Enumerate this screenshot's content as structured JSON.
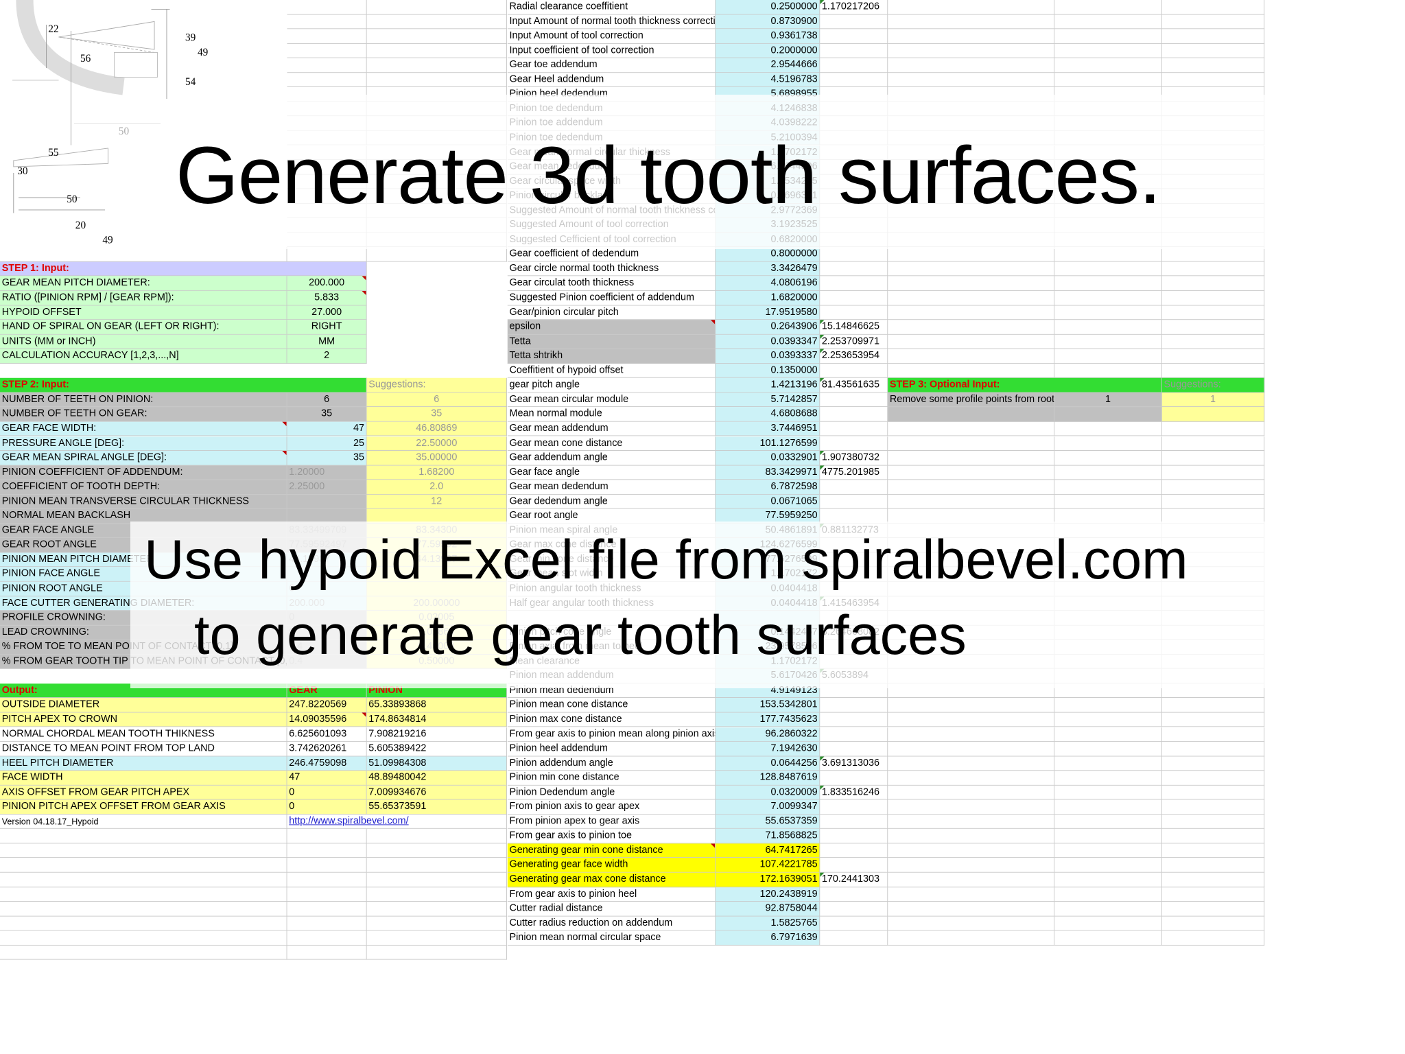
{
  "title_overlay": "Generate 3d tooth surfaces.",
  "subtitle_overlay": [
    "Use hypoid Excel file from spiralbevel.com",
    "to generate gear tooth surfaces"
  ],
  "drawing_labels": [
    "22",
    "39",
    "56",
    "49",
    "54",
    "50",
    "55",
    "30",
    "50",
    "20",
    "49"
  ],
  "colors": {
    "input": "#ccffcc",
    "header": "#33dd33",
    "output": "#ffff99",
    "gray": "#c0c0c0",
    "cyan": "#ccf2f7",
    "highlight": "#ffff00"
  },
  "step1": {
    "header": "STEP 1: Input:",
    "rows": [
      {
        "label": "GEAR MEAN PITCH DIAMETER:",
        "value": "200.000"
      },
      {
        "label": "RATIO ([PINION RPM] / [GEAR RPM]):",
        "value": "5.833"
      },
      {
        "label": "HYPOID OFFSET",
        "value": "27.000"
      },
      {
        "label": "HAND OF SPIRAL ON GEAR (LEFT OR RIGHT):",
        "value": "RIGHT"
      },
      {
        "label": "UNITS (MM or INCH)",
        "value": "MM"
      },
      {
        "label": "CALCULATION ACCURACY [1,2,3,...,N]",
        "value": "2"
      }
    ]
  },
  "step2": {
    "header": "STEP 2: Input:",
    "suggestions_label": "Suggestions:",
    "rows": [
      {
        "label": "NUMBER OF TEETH ON PINION:",
        "value": "6",
        "suggestion": "6"
      },
      {
        "label": "NUMBER OF TEETH ON GEAR:",
        "value": "35",
        "suggestion": "35"
      },
      {
        "label": "GEAR FACE WIDTH:",
        "value": "47",
        "suggestion": "46.80869"
      },
      {
        "label": "PRESSURE ANGLE [DEG]:",
        "value": "25",
        "suggestion": "22.50000"
      },
      {
        "label": "GEAR MEAN SPIRAL ANGLE [DEG]:",
        "value": "35",
        "suggestion": "35.00000"
      },
      {
        "label": "PINION COEFFICIENT OF ADDENDUM:",
        "value": "1.20000",
        "suggestion": "1.68200"
      },
      {
        "label": "COEFFICIENT OF TOOTH DEPTH:",
        "value": "2.25000",
        "suggestion": "2.0"
      },
      {
        "label": "PINION MEAN TRANSVERSE CIRCULAR THICKNESS",
        "value": "",
        "suggestion": "12"
      },
      {
        "label": "NORMAL MEAN BACKLASH",
        "value": "",
        "suggestion": ""
      },
      {
        "label": "GEAR FACE ANGLE",
        "value": "83.33499709",
        "suggestion": "83.34300"
      },
      {
        "label": "GEAR ROOT ANGLE",
        "value": "77.59592497",
        "suggestion": "77.59592"
      },
      {
        "label": "PINION MEAN PITCH DIAMETER",
        "value": "44.13987",
        "suggestion": "44.13987"
      },
      {
        "label": "PINION FACE ANGLE",
        "value": "",
        "suggestion": ""
      },
      {
        "label": "PINION ROOT ANGLE",
        "value": "6",
        "suggestion": ""
      },
      {
        "label": "FACE CUTTER GENERATING DIAMETER:",
        "value": "200.000",
        "suggestion": "200.00000"
      },
      {
        "label": "PROFILE CROWNING:",
        "value": "0",
        "suggestion": "0.02005"
      },
      {
        "label": "LEAD CROWNING:",
        "value": "0",
        "suggestion": "0.02864"
      },
      {
        "label": "% FROM TOE TO MEAN POINT OF CONTACT [0,1]",
        "value": "0.4",
        "suggestion": "0.40000"
      },
      {
        "label": "% FROM GEAR TOOTH TIP TO MEAN POINT OF CONTACT [0,1]",
        "value": "0.4",
        "suggestion": "0.50000"
      }
    ]
  },
  "output": {
    "header": "Output:",
    "col_gear": "GEAR",
    "col_pinion": "PINION",
    "rows": [
      {
        "label": "OUTSIDE DIAMETER",
        "gear": "247.8220569",
        "pinion": "65.33893868"
      },
      {
        "label": "PITCH APEX TO CROWN",
        "gear": "14.09035596",
        "pinion": "174.8634814"
      },
      {
        "label": "NORMAL CHORDAL MEAN TOOTH THIKNESS",
        "gear": "6.625601093",
        "pinion": "7.908219216"
      },
      {
        "label": "DISTANCE TO MEAN POINT FROM TOP LAND",
        "gear": "3.742620261",
        "pinion": "5.605389422"
      },
      {
        "label": "HEEL PITCH DIAMETER",
        "gear": "246.4759098",
        "pinion": "51.09984308"
      },
      {
        "label": "FACE WIDTH",
        "gear": "47",
        "pinion": "48.89480042"
      },
      {
        "label": "AXIS OFFSET FROM GEAR PITCH APEX",
        "gear": "0",
        "pinion": "7.009934676"
      },
      {
        "label": "PINION PITCH APEX OFFSET FROM GEAR AXIS",
        "gear": "0",
        "pinion": "55.65373591"
      }
    ],
    "version": "Version 04.18.17_Hypoid",
    "link": "http://www.spiralbevel.com/"
  },
  "step3": {
    "header": "STEP 3: Optional Input:",
    "suggestions_label": "Suggestions:",
    "label": "Remove some profile points from root",
    "value": "1",
    "suggestion": "1"
  },
  "calc": [
    {
      "label": "Radial clearance coeffitient",
      "value": "0.2500000",
      "extra": "1.170217206"
    },
    {
      "label": "Input Amount of normal tooth thickness correction",
      "value": "0.8730900",
      "extra": ""
    },
    {
      "label": "Input Amount of tool correction",
      "value": "0.9361738",
      "extra": ""
    },
    {
      "label": "Input coefficient of tool correction",
      "value": "0.2000000",
      "extra": ""
    },
    {
      "label": "Gear toe addendum",
      "value": "2.9544666",
      "extra": ""
    },
    {
      "label": "Gear Heel addendum",
      "value": "4.5196783",
      "extra": ""
    },
    {
      "label": "Pinion heel dedendum",
      "value": "5.6898955",
      "extra": ""
    },
    {
      "label": "Pinion toe dedendum",
      "value": "4.1246838",
      "extra": ""
    },
    {
      "label": "Pinion toe addendum",
      "value": "4.0398222",
      "extra": ""
    },
    {
      "label": "Pinion toe dedendum",
      "value": "5.2100394",
      "extra": ""
    },
    {
      "label": "Gear mean normal circular thickness",
      "value": "1.1702172",
      "extra": ""
    },
    {
      "label": "Gear mean dedendum",
      "value": "6.3644806",
      "extra": ""
    },
    {
      "label": "Gear circular space width",
      "value": "1.2534275",
      "extra": ""
    },
    {
      "label": "Pinion circular backlash",
      "value": "0.2696351",
      "extra": ""
    },
    {
      "label": "Suggested Amount of normal tooth thickness correction",
      "value": "2.9772369",
      "extra": ""
    },
    {
      "label": "Suggested Amount of tool correction",
      "value": "3.1923525",
      "extra": ""
    },
    {
      "label": "Suggested Cefficient of tool correction",
      "value": "0.6820000",
      "extra": ""
    },
    {
      "label": "Gear coefficient of dedendum",
      "value": "0.8000000",
      "extra": ""
    },
    {
      "label": "Gear circle normal tooth thickness",
      "value": "3.3426479",
      "extra": ""
    },
    {
      "label": "Gear circulat tooth thickness",
      "value": "4.0806196",
      "extra": ""
    },
    {
      "label": "Suggested Pinion coefficient of addendum",
      "value": "1.6820000",
      "extra": ""
    },
    {
      "label": "Gear/pinion circular pitch",
      "value": "17.9519580",
      "extra": ""
    },
    {
      "label": "epsilon",
      "value": "0.2643906",
      "extra": "15.14846625"
    },
    {
      "label": "Tetta",
      "value": "0.0393347",
      "extra": "2.253709971"
    },
    {
      "label": "Tetta shtrikh",
      "value": "0.0393337",
      "extra": "2.253653954"
    },
    {
      "label": "Coeffitient of hypoid offset",
      "value": "0.1350000",
      "extra": ""
    },
    {
      "label": "gear pitch angle",
      "value": "1.4213196",
      "extra": "81.43561635"
    },
    {
      "label": "Gear mean circular module",
      "value": "5.7142857",
      "extra": ""
    },
    {
      "label": "Mean normal module",
      "value": "4.6808688",
      "extra": ""
    },
    {
      "label": "Gear mean addendum",
      "value": "3.7446951",
      "extra": ""
    },
    {
      "label": "Gear mean cone distance",
      "value": "101.1276599",
      "extra": ""
    },
    {
      "label": "Gear addendum angle",
      "value": "0.0332901",
      "extra": "1.907380732"
    },
    {
      "label": "Gear face angle",
      "value": "83.3429971",
      "extra": "4775.201985"
    },
    {
      "label": "Gear mean dedendum",
      "value": "6.7872598",
      "extra": ""
    },
    {
      "label": "Gear dedendum angle",
      "value": "0.0671065",
      "extra": ""
    },
    {
      "label": "Gear root angle",
      "value": "77.5959250",
      "extra": ""
    },
    {
      "label": "Pinion mean spiral angle",
      "value": "50.4861891",
      "extra": "0.881132773"
    },
    {
      "label": "Gear max cone distance",
      "value": "124.6276599",
      "extra": ""
    },
    {
      "label": "Gear min cone distance",
      "value": "77.6276599",
      "extra": ""
    },
    {
      "label": "Gear mean slot width",
      "value": "1.1702172",
      "extra": ""
    },
    {
      "label": "Pinion angular tooth thickness",
      "value": "0.0404418",
      "extra": ""
    },
    {
      "label": "Half gear angular tooth thickness",
      "value": "0.0404418",
      "extra": "1.415463954"
    },
    {
      "label": "",
      "value": "",
      "extra": ""
    },
    {
      "label": "Pinion pitch cone angle",
      "value": "0.1442457",
      "extra": "8.264668082"
    },
    {
      "label": "Pinion axial from mean to heel",
      "value": "23.9578596",
      "extra": ""
    },
    {
      "label": "Mean clearance",
      "value": "1.1702172",
      "extra": ""
    },
    {
      "label": "Pinion mean addendum",
      "value": "5.6170426",
      "extra": "5.6053894"
    },
    {
      "label": "Pinion mean dedendum",
      "value": "4.9149123",
      "extra": ""
    },
    {
      "label": "Pinion mean cone distance",
      "value": "153.5342801",
      "extra": ""
    },
    {
      "label": "Pinion max cone distance",
      "value": "177.7435623",
      "extra": ""
    },
    {
      "label": "From gear axis to pinion mean along pinion axis",
      "value": "96.2860322",
      "extra": ""
    },
    {
      "label": "Pinion heel addendum",
      "value": "7.1942630",
      "extra": ""
    },
    {
      "label": "Pinion addendum angle",
      "value": "0.0644256",
      "extra": "3.691313036"
    },
    {
      "label": "Pinion min cone distance",
      "value": "128.8487619",
      "extra": ""
    },
    {
      "label": "Pinion Dedendum angle",
      "value": "0.0320009",
      "extra": "1.833516246"
    },
    {
      "label": "From pinion axis to gear apex",
      "value": "7.0099347",
      "extra": ""
    },
    {
      "label": "From pinion apex to gear axis",
      "value": "55.6537359",
      "extra": ""
    },
    {
      "label": "From gear axis to pinion toe",
      "value": "71.8568825",
      "extra": ""
    },
    {
      "label": "Generating gear min cone distance",
      "value": "64.7417265",
      "extra": ""
    },
    {
      "label": "Generating gear face width",
      "value": "107.4221785",
      "extra": ""
    },
    {
      "label": "Generating gear max cone distance",
      "value": "172.1639051",
      "extra": "170.2441303"
    },
    {
      "label": "From gear axis to pinion heel",
      "value": "120.2438919",
      "extra": ""
    },
    {
      "label": "Cutter radial distance",
      "value": "92.8758044",
      "extra": ""
    },
    {
      "label": "Cutter radius reduction on addendum",
      "value": "1.5825765",
      "extra": ""
    },
    {
      "label": "Pinion mean normal circular space",
      "value": "6.7971639",
      "extra": ""
    }
  ]
}
